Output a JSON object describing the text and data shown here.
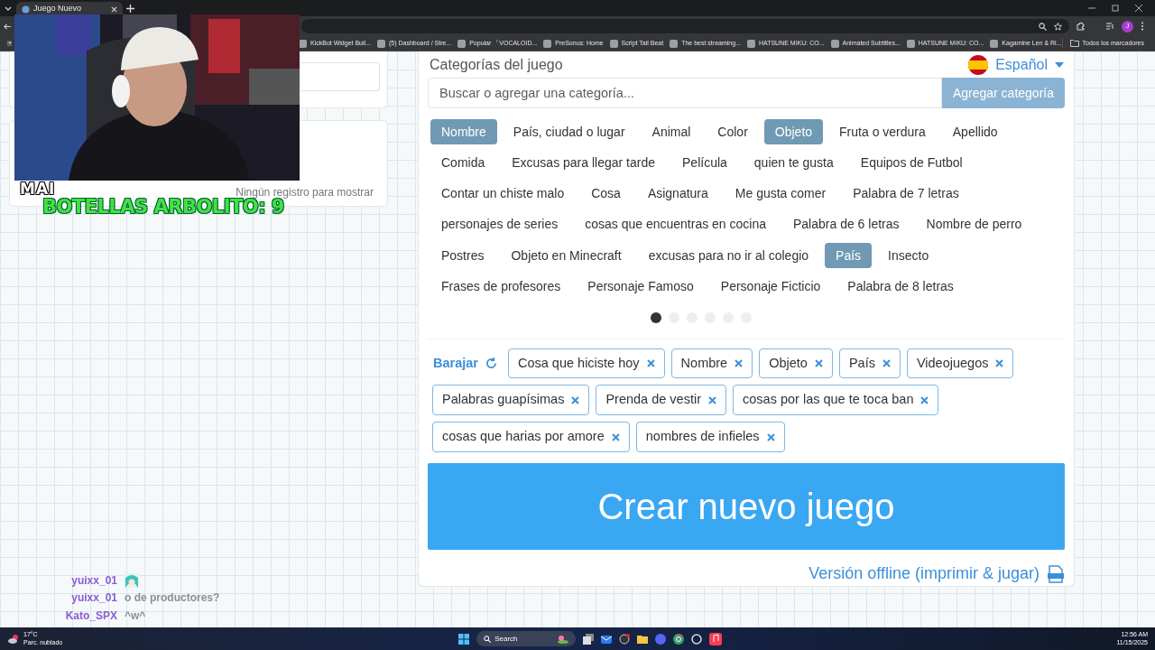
{
  "browser": {
    "tab": {
      "title": "Juego Nuevo"
    },
    "profile": "J",
    "all_bookmarks": "Todos los marcadores",
    "bookmarks": [
      {
        "label": "KickBot Widget Buil..."
      },
      {
        "label": "(5) Dashboard / Stre..."
      },
      {
        "label": "Popular 「VOCALOID..."
      },
      {
        "label": "PreSonus: Home"
      },
      {
        "label": "Script Tail Beat"
      },
      {
        "label": "The best streaming..."
      },
      {
        "label": "HATSUNE MIKU: CO..."
      },
      {
        "label": "Animated Subtitles..."
      },
      {
        "label": "HATSUNE MIKU: CO..."
      },
      {
        "label": "Kagamine Len & Ri..."
      }
    ]
  },
  "left_panel": {
    "empty_message": "Ningún registro para mostrar"
  },
  "stream_overlay": {
    "badge": "MAI",
    "counter": "BOTELLAS ARBOLITO: 9",
    "chat": [
      {
        "user": "yuixx_01",
        "kind": "emote"
      },
      {
        "user": "yuixx_01",
        "kind": "text",
        "message": "o de productores?"
      },
      {
        "user": "Kato_SPX",
        "kind": "text",
        "message": "^w^"
      }
    ]
  },
  "categories": {
    "title": "Categorías del juego",
    "language": "Español",
    "search": {
      "placeholder": "Buscar o agregar una categoría..."
    },
    "add_button": "Agregar categoría",
    "items": [
      {
        "label": "Nombre",
        "selected": true
      },
      {
        "label": "País, ciudad o lugar",
        "selected": false
      },
      {
        "label": "Animal",
        "selected": false
      },
      {
        "label": "Color",
        "selected": false
      },
      {
        "label": "Objeto",
        "selected": true
      },
      {
        "label": "Fruta o verdura",
        "selected": false
      },
      {
        "label": "Apellido",
        "selected": false
      },
      {
        "label": "Comida",
        "selected": false
      },
      {
        "label": "Excusas para llegar tarde",
        "selected": false
      },
      {
        "label": "Película",
        "selected": false
      },
      {
        "label": "quien te gusta",
        "selected": false
      },
      {
        "label": "Equipos de Futbol",
        "selected": false
      },
      {
        "label": "Contar un chiste malo",
        "selected": false
      },
      {
        "label": "Cosa",
        "selected": false
      },
      {
        "label": "Asignatura",
        "selected": false
      },
      {
        "label": "Me gusta comer",
        "selected": false
      },
      {
        "label": "Palabra de 7 letras",
        "selected": false
      },
      {
        "label": "personajes de series",
        "selected": false
      },
      {
        "label": "cosas que encuentras en cocina",
        "selected": false
      },
      {
        "label": "Palabra de 6 letras",
        "selected": false
      },
      {
        "label": "Nombre de perro",
        "selected": false
      },
      {
        "label": "Postres",
        "selected": false
      },
      {
        "label": "Objeto en Minecraft",
        "selected": false
      },
      {
        "label": "excusas para no ir al colegio",
        "selected": false
      },
      {
        "label": "País",
        "selected": true
      },
      {
        "label": "Insecto",
        "selected": false
      },
      {
        "label": "Frases de profesores",
        "selected": false
      },
      {
        "label": "Personaje Famoso",
        "selected": false
      },
      {
        "label": "Personaje Ficticio",
        "selected": false
      },
      {
        "label": "Palabra de 8 letras",
        "selected": false
      }
    ],
    "pages": [
      {
        "selected": true
      },
      {
        "selected": false
      },
      {
        "selected": false
      },
      {
        "selected": false
      },
      {
        "selected": false
      },
      {
        "selected": false
      }
    ]
  },
  "chosen": {
    "shuffle": "Barajar",
    "tags": [
      {
        "label": "Cosa que hiciste hoy"
      },
      {
        "label": "Nombre"
      },
      {
        "label": "Objeto"
      },
      {
        "label": "País"
      },
      {
        "label": "Videojuegos"
      },
      {
        "label": "Palabras guapísimas"
      },
      {
        "label": "Prenda de vestir"
      },
      {
        "label": "cosas por las que te toca ban"
      },
      {
        "label": "cosas que harias por amore"
      },
      {
        "label": "nombres de infieles"
      }
    ]
  },
  "create_button": "Crear nuevo juego",
  "offline_link": "Versión offline (imprimir & jugar)",
  "taskbar": {
    "weather": {
      "temp": "17°C",
      "condition": "Parc. nublado"
    },
    "search": "Search",
    "time": "12:56 AM",
    "date": "11/15/2025"
  }
}
